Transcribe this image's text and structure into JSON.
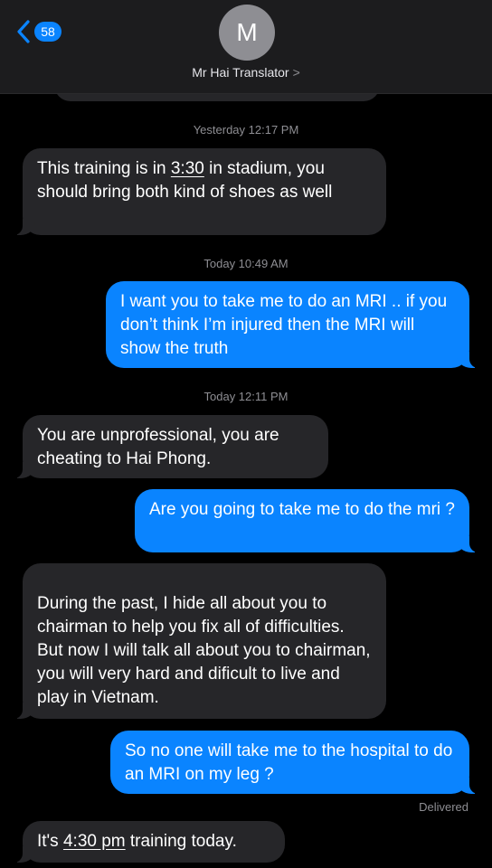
{
  "header": {
    "back_count": "58",
    "avatar_initial": "M",
    "contact_name": "Mr Hai Translator",
    "contact_chevron": ">"
  },
  "messages": [
    {
      "type": "timestamp",
      "text": "Yesterday 12:17 PM"
    },
    {
      "type": "incoming",
      "parts": [
        "This training is in ",
        "3:30",
        " in stadium, you should bring both kind of shoes as well"
      ]
    },
    {
      "type": "timestamp",
      "text": "Today 10:49 AM"
    },
    {
      "type": "outgoing",
      "text": "I want you to take me to do an MRI .. if you don’t think I’m injured then the MRI will show the truth"
    },
    {
      "type": "timestamp",
      "text": "Today 12:11 PM"
    },
    {
      "type": "incoming",
      "text": "You are unprofessional, you are cheating to Hai Phong."
    },
    {
      "type": "outgoing",
      "text": "Are you going to take me to do the mri ?"
    },
    {
      "type": "incoming",
      "text": "During the past, I hide all about you to chairman to help you fix all of difficulties. But now I will talk all about you to chairman, you will very hard and dificult to live and play in Vietnam."
    },
    {
      "type": "outgoing",
      "text": "So no one will take me to the hospital to do an MRI on my leg ?"
    },
    {
      "type": "status",
      "text": "Delivered"
    },
    {
      "type": "incoming",
      "parts": [
        "It's ",
        "4:30 pm",
        " training today."
      ]
    }
  ],
  "colors": {
    "background": "#000000",
    "header_bg": "#1c1c1e",
    "incoming_bubble": "#262629",
    "outgoing_bubble": "#0a84ff",
    "timestamp_text": "#8e8e93"
  },
  "icons": {
    "back": "chevron-left-icon"
  }
}
